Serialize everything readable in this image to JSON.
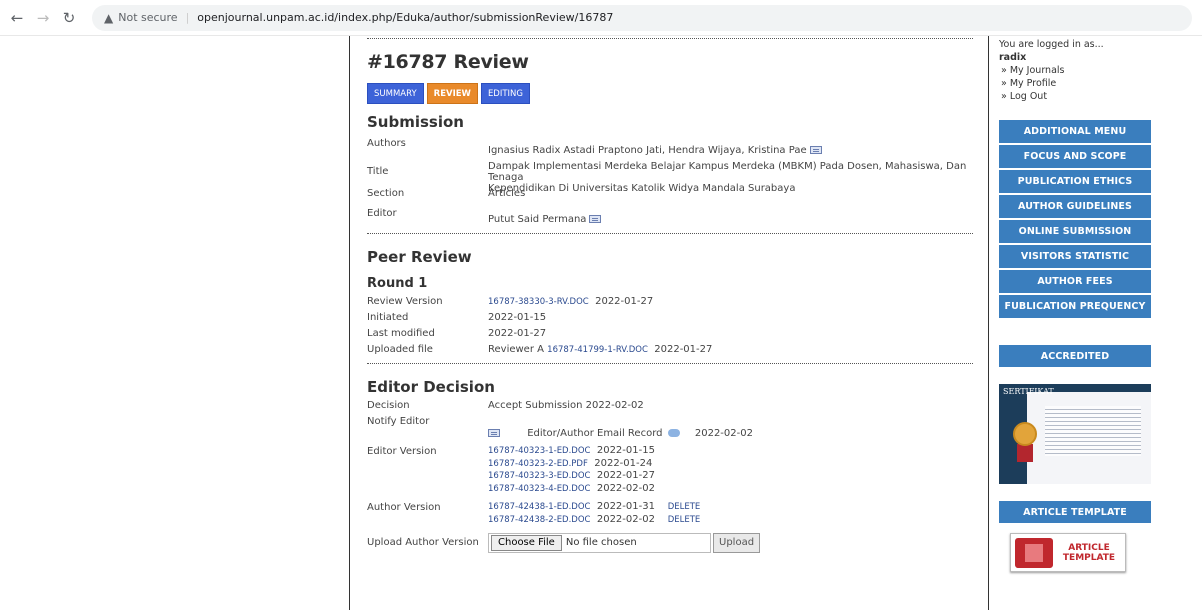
{
  "browser": {
    "security_label": "Not secure",
    "url": "openjournal.unpam.ac.id/index.php/Eduka/author/submissionReview/16787"
  },
  "page": {
    "title": "#16787 Review",
    "tabs": [
      {
        "label": "SUMMARY",
        "active": false
      },
      {
        "label": "REVIEW",
        "active": true
      },
      {
        "label": "EDITING",
        "active": false
      }
    ]
  },
  "submission": {
    "heading": "Submission",
    "authors_label": "Authors",
    "authors": "Ignasius Radix Astadi Praptono Jati, Hendra Wijaya, Kristina Pae",
    "title_label": "Title",
    "title_line1": "Dampak Implementasi Merdeka Belajar Kampus Merdeka (MBKM) Pada Dosen, Mahasiswa, Dan Tenaga",
    "title_line2": "Kependidikan Di Universitas Katolik Widya Mandala Surabaya",
    "section_label": "Section",
    "section": "Articles",
    "editor_label": "Editor",
    "editor": "Putut Said Permana"
  },
  "peer_review": {
    "heading": "Peer Review",
    "round": "Round 1",
    "review_version_label": "Review Version",
    "review_version_file": "16787-38330-3-RV.DOC",
    "review_version_date": "2022-01-27",
    "initiated_label": "Initiated",
    "initiated": "2022-01-15",
    "last_modified_label": "Last modified",
    "last_modified": "2022-01-27",
    "uploaded_file_label": "Uploaded file",
    "uploaded_reviewer": "Reviewer A",
    "uploaded_file": "16787-41799-1-RV.DOC",
    "uploaded_date": "2022-01-27"
  },
  "editor_decision": {
    "heading": "Editor Decision",
    "decision_label": "Decision",
    "decision": "Accept Submission 2022-02-02",
    "notify_label": "Notify Editor",
    "email_record": "Editor/Author Email Record",
    "email_date": "2022-02-02",
    "editor_version_label": "Editor Version",
    "editor_versions": [
      {
        "file": "16787-40323-1-ED.DOC",
        "date": "2022-01-15"
      },
      {
        "file": "16787-40323-2-ED.PDF",
        "date": "2022-01-24"
      },
      {
        "file": "16787-40323-3-ED.DOC",
        "date": "2022-01-27"
      },
      {
        "file": "16787-40323-4-ED.DOC",
        "date": "2022-02-02"
      }
    ],
    "author_version_label": "Author Version",
    "author_versions": [
      {
        "file": "16787-42438-1-ED.DOC",
        "date": "2022-01-31",
        "action": "DELETE"
      },
      {
        "file": "16787-42438-2-ED.DOC",
        "date": "2022-02-02",
        "action": "DELETE"
      }
    ],
    "upload_label": "Upload Author Version",
    "choose_file": "Choose File",
    "no_file": "No file chosen",
    "upload_button": "Upload"
  },
  "sidebar": {
    "logged_in_as": "You are logged in as...",
    "username": "radix",
    "links": [
      "My Journals",
      "My Profile",
      "Log Out"
    ],
    "menu": [
      "ADDITIONAL MENU",
      "FOCUS AND SCOPE",
      "PUBLICATION ETHICS",
      "AUTHOR GUIDELINES",
      "ONLINE SUBMISSION",
      "VISITORS STATISTIC",
      "AUTHOR FEES",
      "FUBLICATION PREQUENCY"
    ],
    "accredited": "ACCREDITED",
    "certificate_title": "SERTIFIKAT",
    "article_template": "ARTICLE TEMPLATE",
    "template_icon_line1": "ARTICLE",
    "template_icon_line2": "TEMPLATE"
  }
}
